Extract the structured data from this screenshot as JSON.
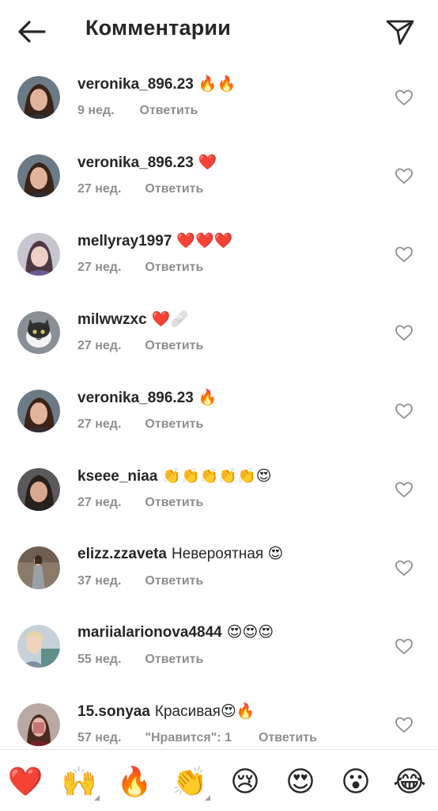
{
  "header": {
    "title": "Комментарии"
  },
  "comments": [
    {
      "username": "veronika_896.23",
      "text": "🔥🔥",
      "time": "9 нед.",
      "reply": "Ответить",
      "avatar": "avatar-dark-hair-woman"
    },
    {
      "username": "veronika_896.23",
      "text": "❤️",
      "time": "27 нед.",
      "reply": "Ответить",
      "avatar": "avatar-dark-hair-woman"
    },
    {
      "username": "mellyray1997",
      "text": "❤️❤️❤️",
      "time": "27 нед.",
      "reply": "Ответить",
      "avatar": "avatar-woman-purple"
    },
    {
      "username": "milwwzxc",
      "text": "❤️🩹",
      "time": "27 нед.",
      "reply": "Ответить",
      "avatar": "avatar-cat"
    },
    {
      "username": "veronika_896.23",
      "text": "🔥",
      "time": "27 нед.",
      "reply": "Ответить",
      "avatar": "avatar-dark-hair-woman"
    },
    {
      "username": "kseee_niaa",
      "text": "👏👏👏👏👏😍",
      "time": "27 нед.",
      "reply": "Ответить",
      "avatar": "avatar-woman-dark"
    },
    {
      "username": "elizz.zzaveta",
      "text": "Невероятная 😍",
      "time": "37 нед.",
      "reply": "Ответить",
      "avatar": "avatar-woman-standing"
    },
    {
      "username": "mariialarionova4844",
      "text": "😍😍😍",
      "time": "55 нед.",
      "reply": "Ответить",
      "avatar": "avatar-woman-light"
    },
    {
      "username": "15.sonyaa",
      "text": "Красивая😍🔥",
      "time": "57 нед.",
      "likes": "\"Нравится\": 1",
      "reply": "Ответить",
      "avatar": "avatar-woman-red"
    }
  ],
  "reactions": [
    {
      "emoji": "❤️",
      "name": "heart"
    },
    {
      "emoji": "🙌",
      "name": "raised-hands"
    },
    {
      "emoji": "🔥",
      "name": "fire"
    },
    {
      "emoji": "👏",
      "name": "clapping-hands"
    },
    {
      "emoji": "😢",
      "name": "crying-face"
    },
    {
      "emoji": "😍",
      "name": "heart-eyes"
    },
    {
      "emoji": "😮",
      "name": "surprised-face"
    },
    {
      "emoji": "😂",
      "name": "tears-of-joy"
    }
  ],
  "colors": {
    "text": "#262626",
    "secondary": "#8e8e8e",
    "heart": "#ed4956"
  }
}
